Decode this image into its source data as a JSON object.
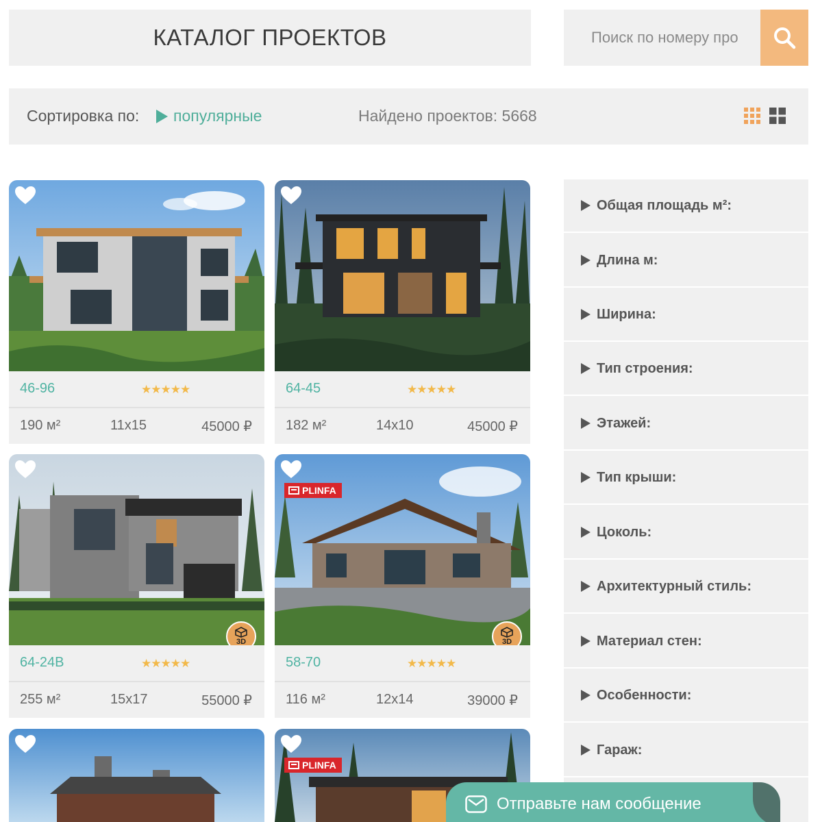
{
  "header": {
    "title": "КАТАЛОГ ПРОЕКТОВ",
    "search_placeholder": "Поиск по номеру про"
  },
  "sort_bar": {
    "sort_label": "Сортировка по:",
    "sort_value": "популярные",
    "found_text": "Найдено проектов: 5668"
  },
  "cards": [
    {
      "code": "46-96",
      "rating": "★★★★★",
      "area": "190 м²",
      "dims": "11x15",
      "price": "45000 ₽",
      "has_3d": false,
      "brand": ""
    },
    {
      "code": "64-45",
      "rating": "★★★★★",
      "area": "182 м²",
      "dims": "14x10",
      "price": "45000 ₽",
      "has_3d": false,
      "brand": ""
    },
    {
      "code": "64-24B",
      "rating": "★★★★★",
      "area": "255 м²",
      "dims": "15x17",
      "price": "55000 ₽",
      "has_3d": true,
      "brand": ""
    },
    {
      "code": "58-70",
      "rating": "★★★★★",
      "area": "116 м²",
      "dims": "12x14",
      "price": "39000 ₽",
      "has_3d": true,
      "brand": "PLINFA"
    },
    {
      "brand": ""
    },
    {
      "brand": "PLINFA"
    }
  ],
  "badge_3d_label": "3D",
  "filters": [
    "Общая площадь м²:",
    "Длина м:",
    "Ширина:",
    "Тип строения:",
    "Этажей:",
    "Тип крыши:",
    "Цоколь:",
    "Архитектурный стиль:",
    "Материал стен:",
    "Особенности:",
    "Гараж:"
  ],
  "chat": {
    "label": "Отправьте нам сообщение"
  },
  "colors": {
    "accent_teal": "#4fae9a",
    "search_orange": "#f3b97e",
    "star": "#f2b94a",
    "panel": "#f0f0f0"
  }
}
